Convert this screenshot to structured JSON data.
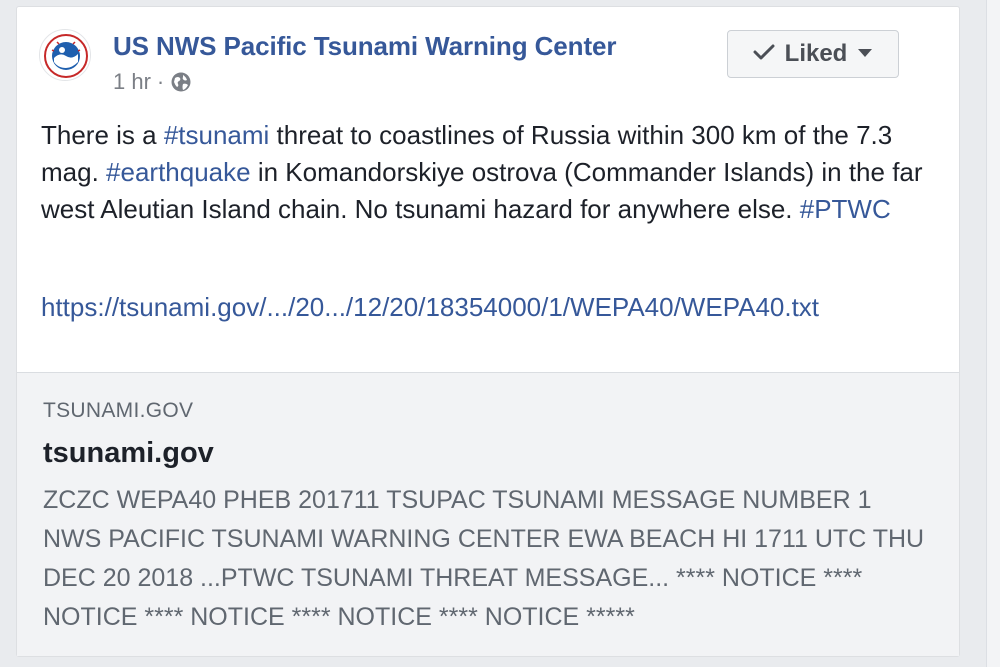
{
  "post": {
    "page_name": "US NWS Pacific Tsunami Warning Center",
    "time": "1 hr",
    "separator": "·",
    "privacy_icon": "globe-icon",
    "avatar_icon": "nws-logo-icon",
    "liked_button": {
      "label": "Liked",
      "check_icon": "check-icon",
      "dropdown_icon": "caret-down-icon"
    },
    "text": {
      "part1": "There is a ",
      "hashtag_tsunami": "#tsunami",
      "part2": " threat to coastlines of Russia within 300 km of the 7.3 mag. ",
      "hashtag_earthquake": "#earthquake",
      "part3": " in Komandorskiye ostrova (Commander Islands) in the far west Aleutian Island chain. No tsunami hazard for anywhere else. ",
      "hashtag_ptwc": "#PTWC"
    },
    "link": "https://tsunami.gov/.../20.../12/20/18354000/1/WEPA40/WEPA40.txt"
  },
  "preview": {
    "domain": "TSUNAMI.GOV",
    "title": "tsunami.gov",
    "description": "ZCZC WEPA40 PHEB 201711 TSUPAC TSUNAMI MESSAGE NUMBER 1 NWS PACIFIC TSUNAMI WARNING CENTER EWA BEACH HI 1711 UTC THU DEC 20 2018 ...PTWC TSUNAMI THREAT MESSAGE... **** NOTICE **** NOTICE **** NOTICE **** NOTICE **** NOTICE *****"
  },
  "colors": {
    "link": "#365899",
    "text": "#1d2129",
    "muted": "#606770",
    "card_bg": "#ffffff",
    "preview_bg": "#f2f3f5"
  }
}
